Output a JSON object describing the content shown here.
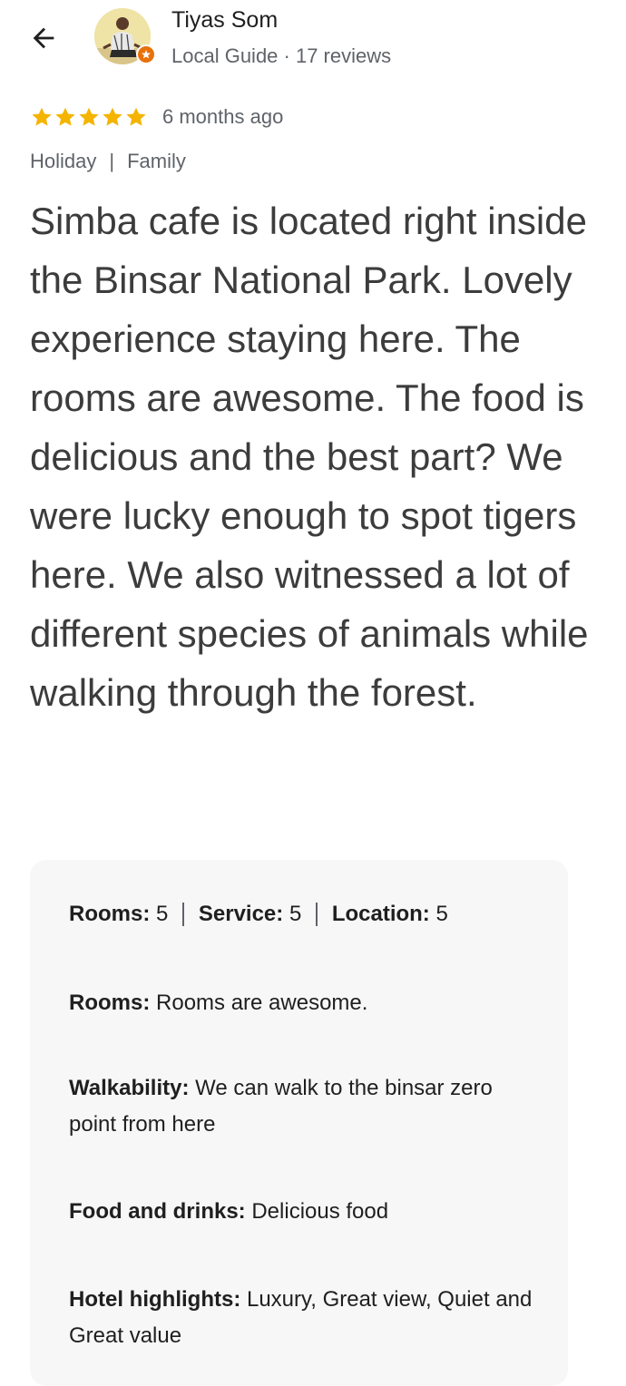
{
  "header": {
    "back_icon": "arrow-back-icon",
    "reviewer": {
      "name": "Tiyas Som",
      "meta": "Local Guide · 17 reviews",
      "badge_icon": "local-guide-badge-icon",
      "badge_color": "#e8710a"
    }
  },
  "review": {
    "stars": 5,
    "star_color": "#f4b400",
    "time_ago": "6 months ago",
    "tags": [
      "Holiday",
      "Family"
    ],
    "tag_separator": "|",
    "text": "Simba cafe is located right inside the Binsar National Park. Lovely experience staying here. The rooms are awesome. The food is delicious and the best part? We were lucky enough to spot tigers here. We also witnessed a lot of different species of animals while walking through the forest."
  },
  "details": {
    "scores": [
      {
        "label": "Rooms:",
        "value": "5"
      },
      {
        "label": "Service:",
        "value": "5"
      },
      {
        "label": "Location:",
        "value": "5"
      }
    ],
    "items": [
      {
        "label": "Rooms:",
        "value": "Rooms are awesome."
      },
      {
        "label": "Walkability:",
        "value": "We can walk to the binsar zero point from here"
      },
      {
        "label": "Food and drinks:",
        "value": "Delicious food"
      },
      {
        "label": "Hotel highlights:",
        "value": "Luxury, Great view, Quiet and Great value"
      }
    ]
  }
}
